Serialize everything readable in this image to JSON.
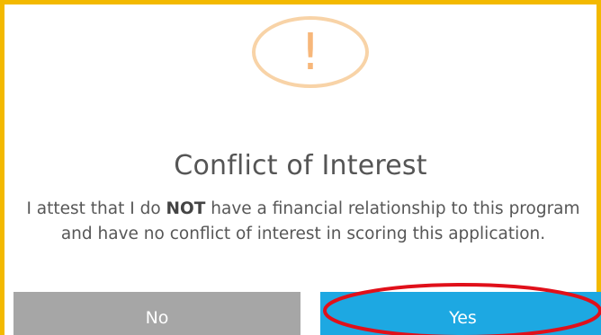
{
  "dialog": {
    "icon": "exclamation-warning-icon",
    "icon_glyph": "!",
    "title": "Conflict of Interest",
    "message_before": "I attest that I do ",
    "message_emphasis": "NOT",
    "message_after": " have a financial relationship to this program and have no conflict of interest in scoring this application.",
    "buttons": {
      "no_label": "No",
      "yes_label": "Yes"
    }
  },
  "colors": {
    "frame_border": "#f3b900",
    "icon_ring": "#f8d3a7",
    "icon_glyph": "#f7b77a",
    "no_button": "#a6a6a6",
    "yes_button": "#1da8e2",
    "annotation": "#e0101a"
  }
}
